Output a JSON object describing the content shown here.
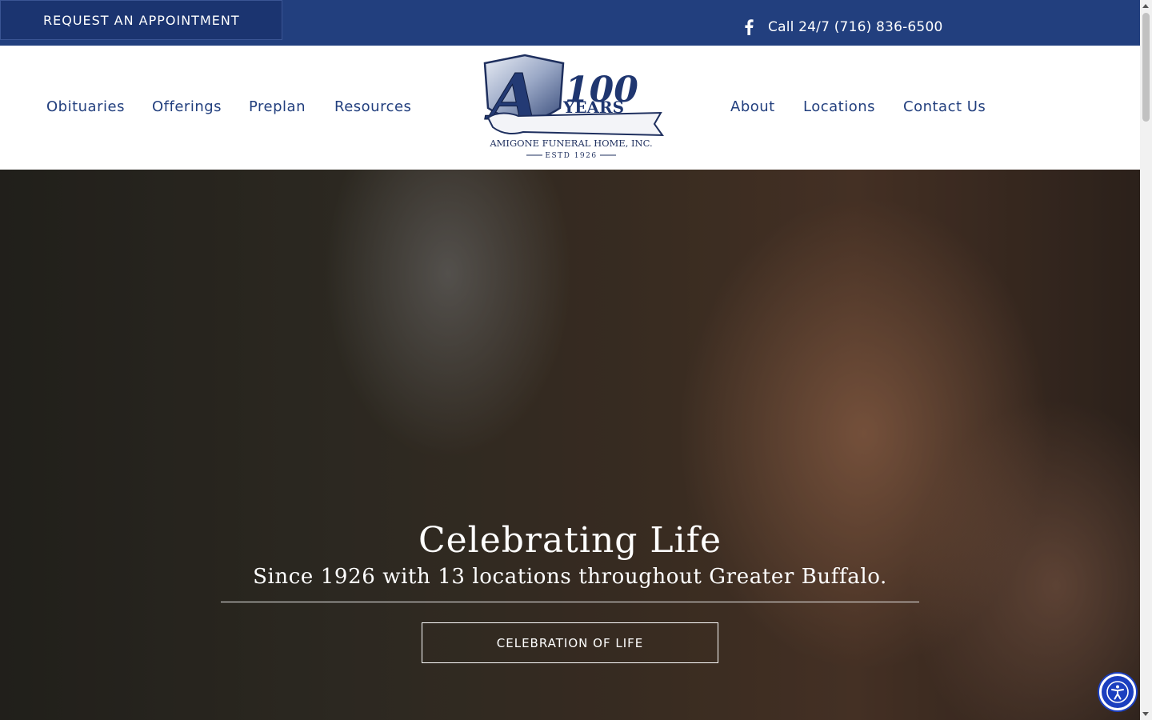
{
  "topbar": {
    "appointment_label": "REQUEST AN APPOINTMENT",
    "facebook_icon": "facebook-icon",
    "call_text": "Call 24/7 (716) 836-6500"
  },
  "nav": {
    "left": [
      "Obituaries",
      "Offerings",
      "Preplan",
      "Resources"
    ],
    "right": [
      "About",
      "Locations",
      "Contact Us"
    ]
  },
  "logo": {
    "monogram": "A",
    "years_number": "100",
    "years_word": "YEARS",
    "company": "AMIGONE FUNERAL HOME, INC.",
    "established": "ESTD 1926"
  },
  "hero": {
    "title": "Celebrating Life",
    "subtitle": "Since 1926 with 13 locations throughout Greater Buffalo.",
    "button_label": "CELEBRATION OF LIFE"
  },
  "colors": {
    "brand_navy": "#223f7e",
    "accessibility_blue": "#1b3fbf"
  },
  "accessibility": {
    "icon": "accessibility-icon"
  }
}
